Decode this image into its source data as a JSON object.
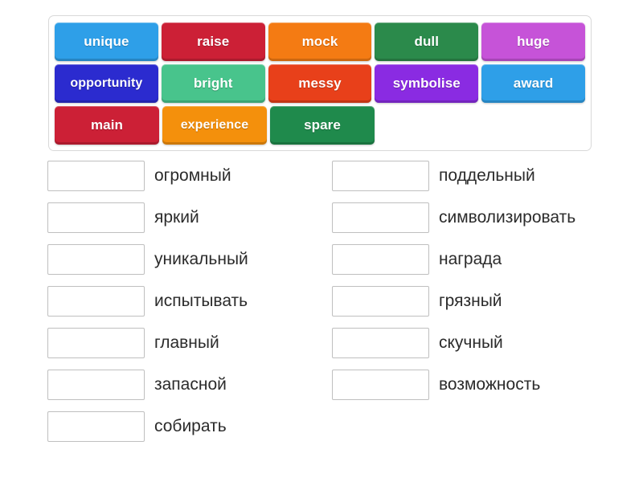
{
  "word_bank": {
    "rows": [
      [
        {
          "label": "unique",
          "color": "#2e9fe8"
        },
        {
          "label": "raise",
          "color": "#cc2036"
        },
        {
          "label": "mock",
          "color": "#f47b13"
        },
        {
          "label": "dull",
          "color": "#2b8a4b"
        },
        {
          "label": "huge",
          "color": "#c653d8"
        }
      ],
      [
        {
          "label": "opportunity",
          "color": "#2b2bcf"
        },
        {
          "label": "bright",
          "color": "#48c48c"
        },
        {
          "label": "messy",
          "color": "#e8401a"
        },
        {
          "label": "symbolise",
          "color": "#8a2be2"
        },
        {
          "label": "award",
          "color": "#2e9fe8"
        }
      ],
      [
        {
          "label": "main",
          "color": "#cc2036"
        },
        {
          "label": "experience",
          "color": "#f4900c"
        },
        {
          "label": "spare",
          "color": "#1f8a4c"
        }
      ]
    ]
  },
  "matches": {
    "left_column": [
      {
        "answer": "",
        "label": "огромный"
      },
      {
        "answer": "",
        "label": "яркий"
      },
      {
        "answer": "",
        "label": "уникальный"
      },
      {
        "answer": "",
        "label": "испытывать"
      },
      {
        "answer": "",
        "label": "главный"
      },
      {
        "answer": "",
        "label": "запасной"
      },
      {
        "answer": "",
        "label": "собирать"
      }
    ],
    "right_column": [
      {
        "answer": "",
        "label": "поддельный"
      },
      {
        "answer": "",
        "label": "символизировать"
      },
      {
        "answer": "",
        "label": "награда"
      },
      {
        "answer": "",
        "label": "грязный"
      },
      {
        "answer": "",
        "label": "скучный"
      },
      {
        "answer": "",
        "label": "возможность"
      }
    ]
  },
  "colors": {
    "page_background": "#ffffff",
    "container_border": "#d9d9d9",
    "box_border": "#bfbfbf",
    "label_text": "#2b2b2b",
    "tile_text": "#ffffff"
  }
}
